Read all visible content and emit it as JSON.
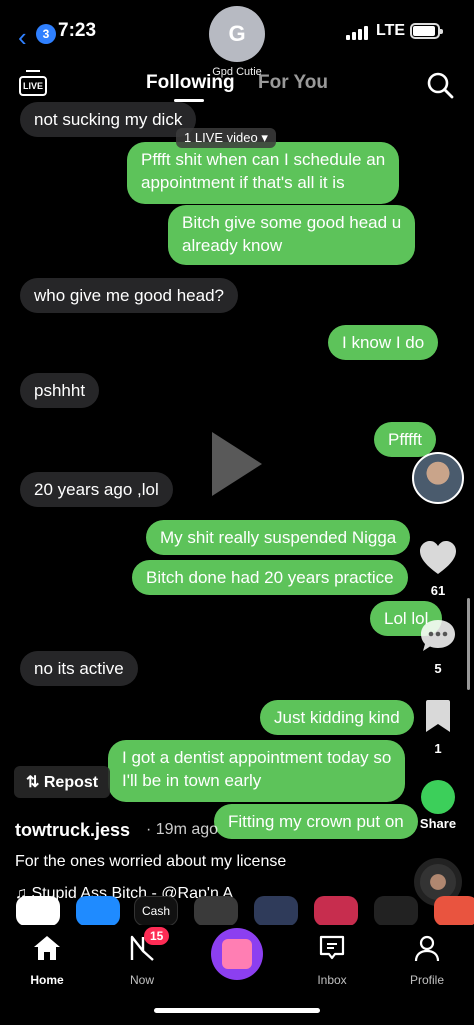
{
  "status_bar": {
    "back_count": "3",
    "time": "7:23",
    "contact_initial": "G",
    "contact_name": "Gpd Cutie",
    "network": "LTE"
  },
  "top_nav": {
    "live_label": "LIVE",
    "tab_following": "Following",
    "tab_for_you": "For You",
    "live_pill": "1 LIVE video ▾"
  },
  "messages": [
    {
      "side": "recv",
      "text": "not sucking my dick"
    },
    {
      "side": "sent",
      "text": "Pffft shit when can I schedule an"
    },
    {
      "side": "sent",
      "text": "appointment if that's all it is"
    },
    {
      "side": "sent",
      "text": "Bitch give some good head u"
    },
    {
      "side": "sent",
      "text": "already know"
    },
    {
      "side": "recv",
      "text": "who give me good head?"
    },
    {
      "side": "sent",
      "text": "I know I do"
    },
    {
      "side": "recv",
      "text": "pshhht"
    },
    {
      "side": "sent",
      "text": "Pfffft"
    },
    {
      "side": "recv",
      "text": "20 years ago ,lol"
    },
    {
      "side": "sent",
      "text": "My shit really suspended Nigga"
    },
    {
      "side": "sent",
      "text": "Bitch done had 20 years practice"
    },
    {
      "side": "sent",
      "text": "Lol lol"
    },
    {
      "side": "recv",
      "text": "no its active"
    },
    {
      "side": "sent",
      "text": "Just kidding kind"
    },
    {
      "side": "sent",
      "text": "I got a dentist appointment today so"
    },
    {
      "side": "sent",
      "text": "I'll be in town early"
    },
    {
      "side": "sent",
      "text": "Fitting my crown put on"
    }
  ],
  "right_rail": {
    "likes": "61",
    "comments": "5",
    "favorites": "1",
    "share_label": "Share"
  },
  "post": {
    "repost_label": "Repost",
    "author": "towtruck.jess",
    "time_ago": "· 19m ago",
    "caption": "For the ones worried about my license",
    "music": "Stupid Ass Bitch - @Rap'n A"
  },
  "dock": {
    "cash_label": "Cash"
  },
  "bottom_nav": {
    "home": "Home",
    "now": "Now",
    "now_badge": "15",
    "inbox": "Inbox",
    "profile": "Profile"
  },
  "colors": {
    "sent_bubble": "#5dc35a",
    "recv_bubble": "#262628",
    "badge_red": "#fe2c55",
    "ios_blue": "#2f80ff"
  }
}
